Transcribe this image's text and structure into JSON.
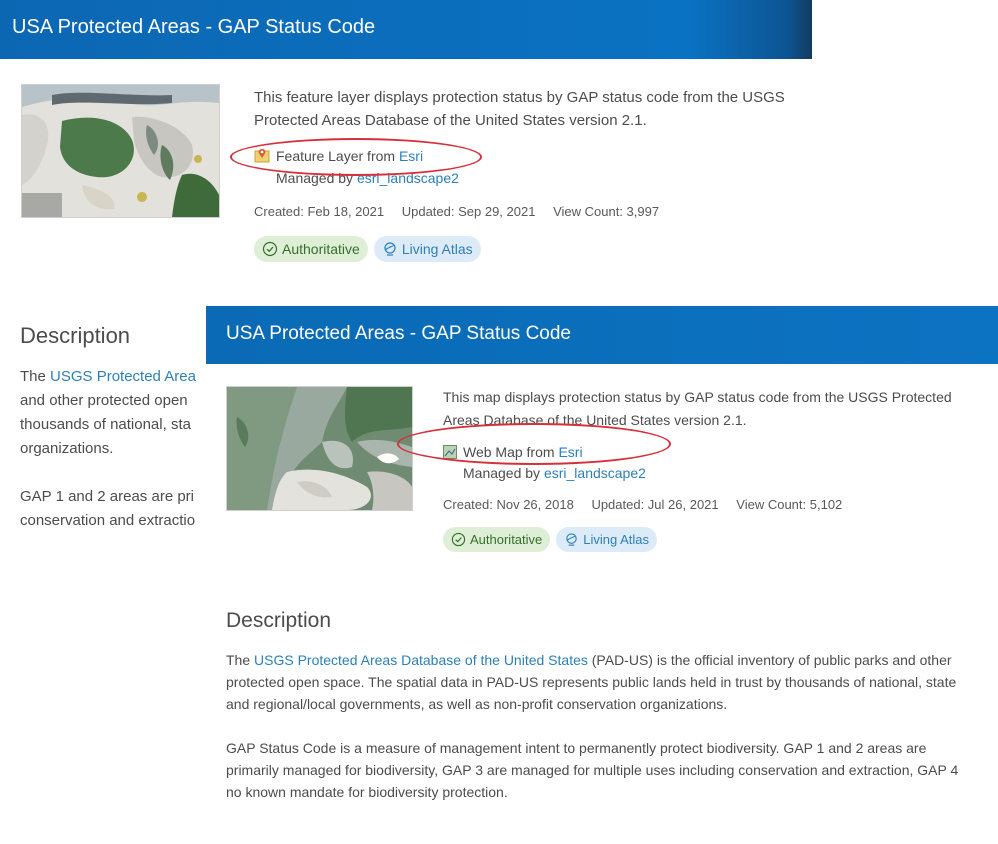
{
  "panel1": {
    "title": "USA Protected Areas - GAP Status Code",
    "summary": "This feature layer displays protection status by GAP status code from the USGS Protected Areas Database of the United States version 2.1.",
    "item_type_prefix": "Feature Layer from ",
    "item_type_owner": "Esri",
    "managed_prefix": "Managed by ",
    "managed_owner": "esri_landscape2",
    "created": "Created: Feb 18, 2021",
    "updated": "Updated: Sep 29, 2021",
    "views": "View Count: 3,997",
    "badge_authoritative": "Authoritative",
    "badge_living_atlas": "Living Atlas",
    "description_heading": "Description",
    "description_line1_prefix": "The ",
    "description_line1_link": "USGS Protected Area",
    "description_line2": "and other protected open",
    "description_line3": "thousands of national, sta",
    "description_line4": "organizations.",
    "description2_line1": "GAP 1 and 2 areas are pri",
    "description2_line2": "conservation and extractio"
  },
  "panel2": {
    "title": "USA Protected Areas - GAP Status Code",
    "summary": "This map displays protection status by GAP status code from the USGS Protected Areas Database of the United States version 2.1.",
    "item_type_prefix": "Web Map from ",
    "item_type_owner": "Esri",
    "managed_prefix": "Managed by ",
    "managed_owner": "esri_landscape2",
    "created": "Created: Nov 26, 2018",
    "updated": "Updated: Jul 26, 2021",
    "views": "View Count: 5,102",
    "badge_authoritative": "Authoritative",
    "badge_living_atlas": "Living Atlas",
    "description_heading": "Description",
    "description_p1_prefix": "The ",
    "description_p1_link": "USGS Protected Areas Database of the United States",
    "description_p1_rest": " (PAD-US) is the official inventory of public parks and other protected open space. The spatial data in PAD-US represents public lands held in trust by thousands of national, state and regional/local governments, as well as non-profit conservation organizations.",
    "description_p2": "GAP Status Code is a measure of management intent to permanently protect biodiversity.  GAP 1 and 2 areas are primarily managed for biodiversity, GAP 3 are managed for multiple uses including conservation and extraction, GAP 4 no known mandate for biodiversity protection."
  },
  "colors": {
    "header_blue": "#0a72c2",
    "link_blue": "#2d7fb9",
    "annotation_red": "#d6303a",
    "authoritative_bg": "#dfeed7",
    "living_atlas_bg": "#dcebf7"
  },
  "icons": {
    "feature_layer": "feature-layer-icon",
    "web_map": "web-map-icon",
    "authoritative": "check-circle-icon",
    "living_atlas": "living-atlas-icon"
  }
}
